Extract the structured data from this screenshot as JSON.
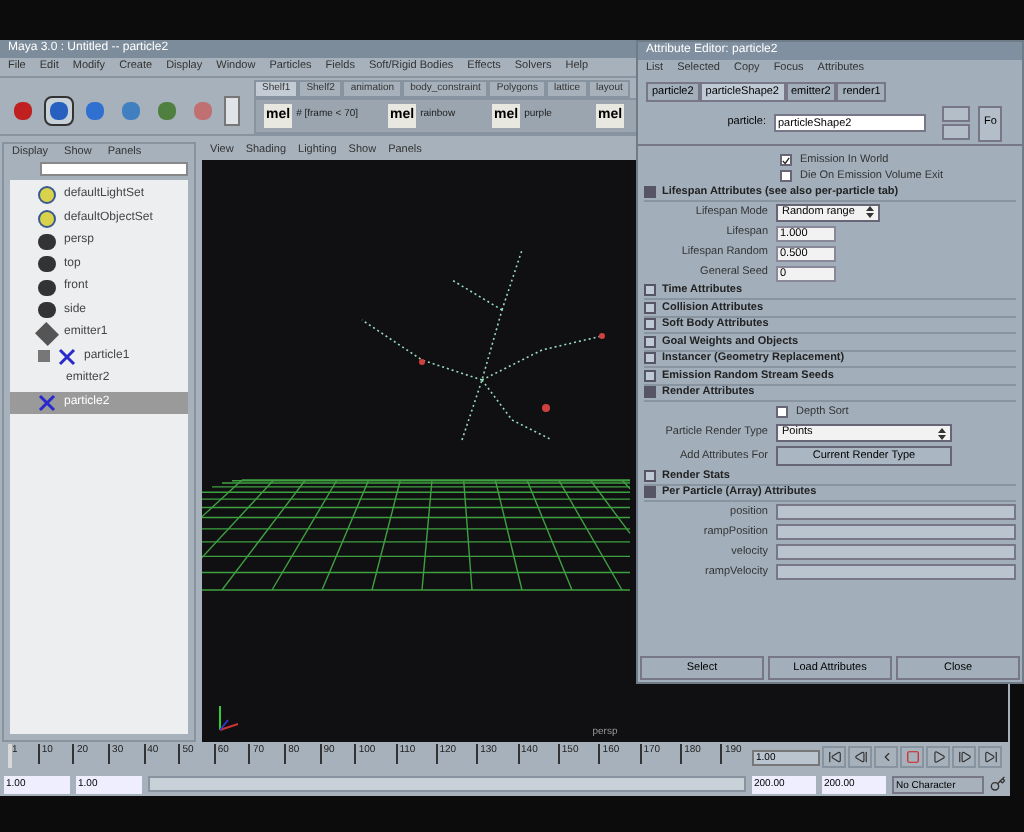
{
  "window": {
    "title": "Maya 3.0 : Untitled  --  particle2"
  },
  "menu": [
    "File",
    "Edit",
    "Modify",
    "Create",
    "Display",
    "Window",
    "Particles",
    "Fields",
    "Soft/Rigid Bodies",
    "Effects",
    "Solvers",
    "Help"
  ],
  "shelf_tabs": [
    {
      "label": "Shelf1",
      "selected": true
    },
    {
      "label": "Shelf2",
      "selected": false
    },
    {
      "label": "animation",
      "selected": false
    },
    {
      "label": "body_constraint",
      "selected": false
    },
    {
      "label": "Polygons",
      "selected": false
    },
    {
      "label": "lattice",
      "selected": false
    },
    {
      "label": "layout",
      "selected": false
    }
  ],
  "shelf_items": [
    {
      "icon": "mel",
      "label": "# [frame < 70]"
    },
    {
      "icon": "mel",
      "label": "rainbow"
    },
    {
      "icon": "mel",
      "label": "purple"
    },
    {
      "icon": "mel"
    }
  ],
  "outliner": {
    "menu": [
      "Display",
      "Show",
      "Panels"
    ],
    "items": [
      {
        "label": "defaultLightSet",
        "kind": "set",
        "selected": false
      },
      {
        "label": "defaultObjectSet",
        "kind": "set",
        "selected": false
      },
      {
        "label": "persp",
        "kind": "camera",
        "selected": false
      },
      {
        "label": "top",
        "kind": "camera",
        "selected": false
      },
      {
        "label": "front",
        "kind": "camera",
        "selected": false
      },
      {
        "label": "side",
        "kind": "camera",
        "selected": false
      },
      {
        "label": "emitter1",
        "kind": "emitter",
        "selected": false
      },
      {
        "label": "particle1",
        "kind": "particle",
        "selected": false,
        "expanded": true,
        "children": [
          {
            "label": "emitter2",
            "selected": false
          }
        ]
      },
      {
        "label": "particle2",
        "kind": "particle",
        "selected": true
      }
    ]
  },
  "viewport": {
    "menu": [
      "View",
      "Shading",
      "Lighting",
      "Show",
      "Panels"
    ],
    "camera_label": "persp"
  },
  "attribute_editor": {
    "title": "Attribute Editor: particle2",
    "menu": [
      "List",
      "Selected",
      "Copy",
      "Focus",
      "Attributes"
    ],
    "tabs": [
      {
        "label": "particle2",
        "selected": false
      },
      {
        "label": "particleShape2",
        "selected": true
      },
      {
        "label": "emitter2",
        "selected": false
      },
      {
        "label": "render1",
        "selected": false
      }
    ],
    "node_label": "particle:",
    "node_value": "particleShape2",
    "side_button": "Fo",
    "checks": [
      {
        "label": "Emission In World",
        "checked": true
      },
      {
        "label": "Die On Emission Volume Exit",
        "checked": false
      }
    ],
    "sections": [
      {
        "title": "Lifespan Attributes (see also per-particle tab)",
        "expanded": true,
        "rows": [
          {
            "kind": "dropdown",
            "label": "Lifespan Mode",
            "value": "Random range"
          },
          {
            "kind": "field",
            "label": "Lifespan",
            "value": "1.000"
          },
          {
            "kind": "field",
            "label": "Lifespan Random",
            "value": "0.500"
          },
          {
            "kind": "field",
            "label": "General Seed",
            "value": "0"
          }
        ]
      },
      {
        "title": "Time Attributes",
        "expanded": false
      },
      {
        "title": "Collision Attributes",
        "expanded": false
      },
      {
        "title": "Soft Body Attributes",
        "expanded": false
      },
      {
        "title": "Goal Weights and Objects",
        "expanded": false
      },
      {
        "title": "Instancer (Geometry Replacement)",
        "expanded": false
      },
      {
        "title": "Emission Random Stream Seeds",
        "expanded": false
      },
      {
        "title": "Render Attributes",
        "expanded": true,
        "rows": [
          {
            "kind": "checkbox",
            "label": "Depth Sort",
            "checked": false
          },
          {
            "kind": "dropdown",
            "label": "Particle Render Type",
            "value": "Points"
          },
          {
            "kind": "button",
            "label": "Add Attributes For",
            "value": "Current Render Type"
          }
        ]
      },
      {
        "title": "Render Stats",
        "expanded": false
      },
      {
        "title": "Per Particle (Array) Attributes",
        "expanded": true,
        "rows": [
          {
            "kind": "wide_field",
            "label": "position"
          },
          {
            "kind": "wide_field",
            "label": "rampPosition"
          },
          {
            "kind": "wide_field",
            "label": "velocity"
          },
          {
            "kind": "wide_field",
            "label": "rampVelocity"
          }
        ]
      }
    ],
    "buttons": [
      "Select",
      "Load Attributes",
      "Close"
    ]
  },
  "timeline": {
    "ticks": [
      "1",
      "10",
      "20",
      "30",
      "40",
      "50",
      "60",
      "70",
      "80",
      "90",
      "100",
      "110",
      "120",
      "130",
      "140",
      "150",
      "160",
      "170",
      "180",
      "190"
    ],
    "current_frame": "1.00",
    "level": 0
  },
  "range": {
    "start": "1.00",
    "playback_start": "1.00",
    "playback_end": "200.00",
    "end": "200.00",
    "character": "No Character",
    "level": 1
  }
}
